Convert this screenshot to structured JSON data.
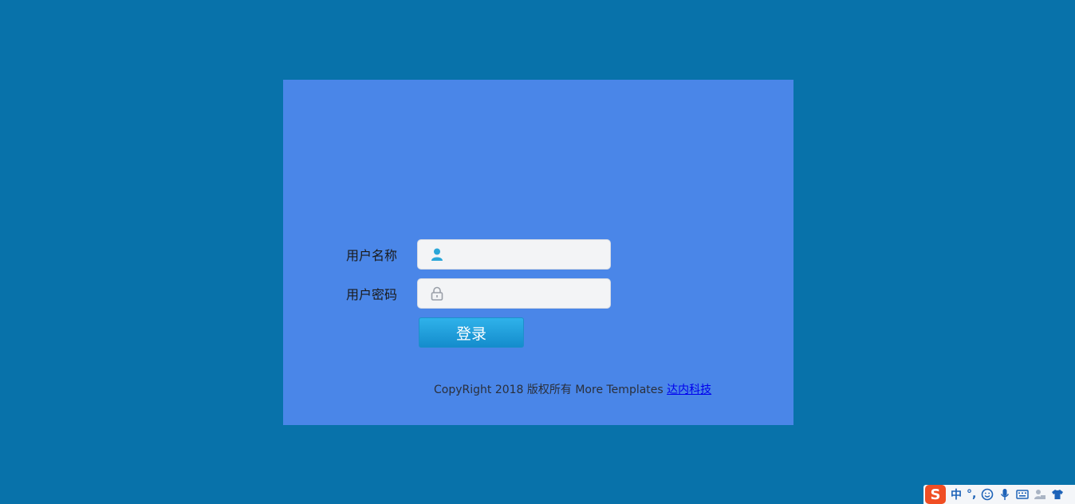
{
  "login": {
    "username_label": "用户名称",
    "password_label": "用户密码",
    "username_value": "",
    "password_value": "",
    "submit_label": "登录"
  },
  "footer": {
    "text": "CopyRight 2018 版权所有 More Templates ",
    "link_text": "达内科技"
  },
  "ime": {
    "logo": "S",
    "mode": "中",
    "punct": "°,",
    "icons": [
      "smile-icon",
      "microphone-icon",
      "keyboard-icon",
      "user-icon",
      "skin-icon"
    ]
  },
  "colors": {
    "page_bg": "#0872aa",
    "panel_bg": "#4a86e8",
    "button": "#1e9fdd",
    "link": "#0000ee"
  }
}
